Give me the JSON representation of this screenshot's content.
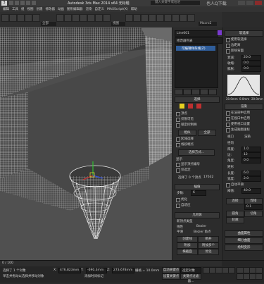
{
  "window": {
    "title": "Autodesk 3ds Max  2014 x64    无标题",
    "search_placeholder": "键入关键字或短语",
    "watermark": "也人Q下载"
  },
  "menu": {
    "items": [
      "编辑",
      "工具",
      "组",
      "视图",
      "创建",
      "修改器",
      "动画",
      "图形编辑器",
      "渲染",
      "自定义",
      "MAXScript(X)",
      "帮助"
    ]
  },
  "toolbar": {
    "selection_filter": "全部",
    "view_select": "视图",
    "macro": "Macro2"
  },
  "modifier_panel": {
    "object_name": "Line001",
    "modifier_list": "修改器列表",
    "stack_item": "可编辑样条线(Z)",
    "section_selection": "选择",
    "radio_vertex": "顶点",
    "radio_named": "仅限可见",
    "check_show": "显示",
    "label_soft_sel_area": "软选择",
    "label_lock": "锁定控制柄",
    "label_similar": "相似",
    "label_all": "全部",
    "label_region": "区域选择",
    "label_segment_end": "线段端点",
    "label_select_by": "选择方式...",
    "label_display": "显示",
    "label_show_vertex": "显示顶点编号",
    "label_selected_only": "仅选定",
    "status_text": "选择了 0 个顶点",
    "count_value": "17632"
  },
  "soft_selection": {
    "title": "软选择",
    "use_soft": "使用软选择",
    "edge_distance": "边距离",
    "effect_back": "影响背面",
    "falloff_label": "衰减:",
    "falloff_value": "20.0",
    "pinch_label": "收缩:",
    "pinch_value": "0.0",
    "bubble_label": "膨胀:",
    "bubble_value": "0.0",
    "curve_min": "20.0mm",
    "curve_zero": "0.0mm",
    "curve_max": "20.0mm"
  },
  "render_panel": {
    "title": "渲染",
    "in_renderer": "在渲染中启用",
    "in_viewport": "在视口中启用",
    "use_viewport_settings": "使用视口设置",
    "generate_mapping": "生成贴图坐标",
    "real_world": "真实世界贴图大小",
    "viewport_label": "视口",
    "renderer_label": "渲染",
    "radial": "径向",
    "thickness_label": "厚度:",
    "thickness_value": "1.0",
    "sides_label": "边:",
    "sides_value": "12",
    "angle_label": "角度:",
    "angle_value": "0.0",
    "rectangular": "矩形",
    "length_label": "长度:",
    "length_value": "6.0",
    "width_label": "宽度:",
    "width_value": "2.0",
    "auto_smooth": "自动平滑",
    "threshold_label": "阈值:",
    "threshold_value": "40.0"
  },
  "interpolation": {
    "title": "插值",
    "steps_label": "步数:",
    "steps_value": "6",
    "optimize": "优化",
    "adaptive": "自适应"
  },
  "geometry": {
    "title": "几何体",
    "new_vertex_type": "新顶点类型",
    "linear": "线性",
    "smooth": "平滑",
    "bezier": "Bezier",
    "bezier_corner": "Bezier 角点",
    "create_line": "创建线",
    "break": "断开",
    "attach": "附加",
    "attach_mult": "附加多个",
    "reorient": "重定向",
    "cross_section": "横截面",
    "refine": "优化",
    "connect": "连接",
    "auto_weld": "自动焊接",
    "weld": "焊接",
    "weld_value": "0.1",
    "bind": "绑定",
    "unbind": "取消绑定",
    "fillet": "圆角",
    "chamfer": "切角",
    "outline": "轮廓"
  },
  "rollouts": [
    "曲面属性",
    "细分曲面",
    "绘制变形"
  ],
  "statusbar": {
    "frame_counter": "0 / 100",
    "x_label": "X:",
    "x_value": "476.823mm",
    "y_label": "Y:",
    "y_value": "-690.3mm",
    "z_label": "Z:",
    "z_value": "273.678mm",
    "grid_label": "栅格 = 10.0mm",
    "auto_key": "自动关键点",
    "selected_label": "选定对象",
    "set_key": "设置关键点",
    "key_filters": "关键点过滤器...",
    "prompt_1": "选择了 1 个对象",
    "prompt_2": "单击并拖动以选择并移动对象",
    "add_time_tag": "添加时间标记"
  }
}
